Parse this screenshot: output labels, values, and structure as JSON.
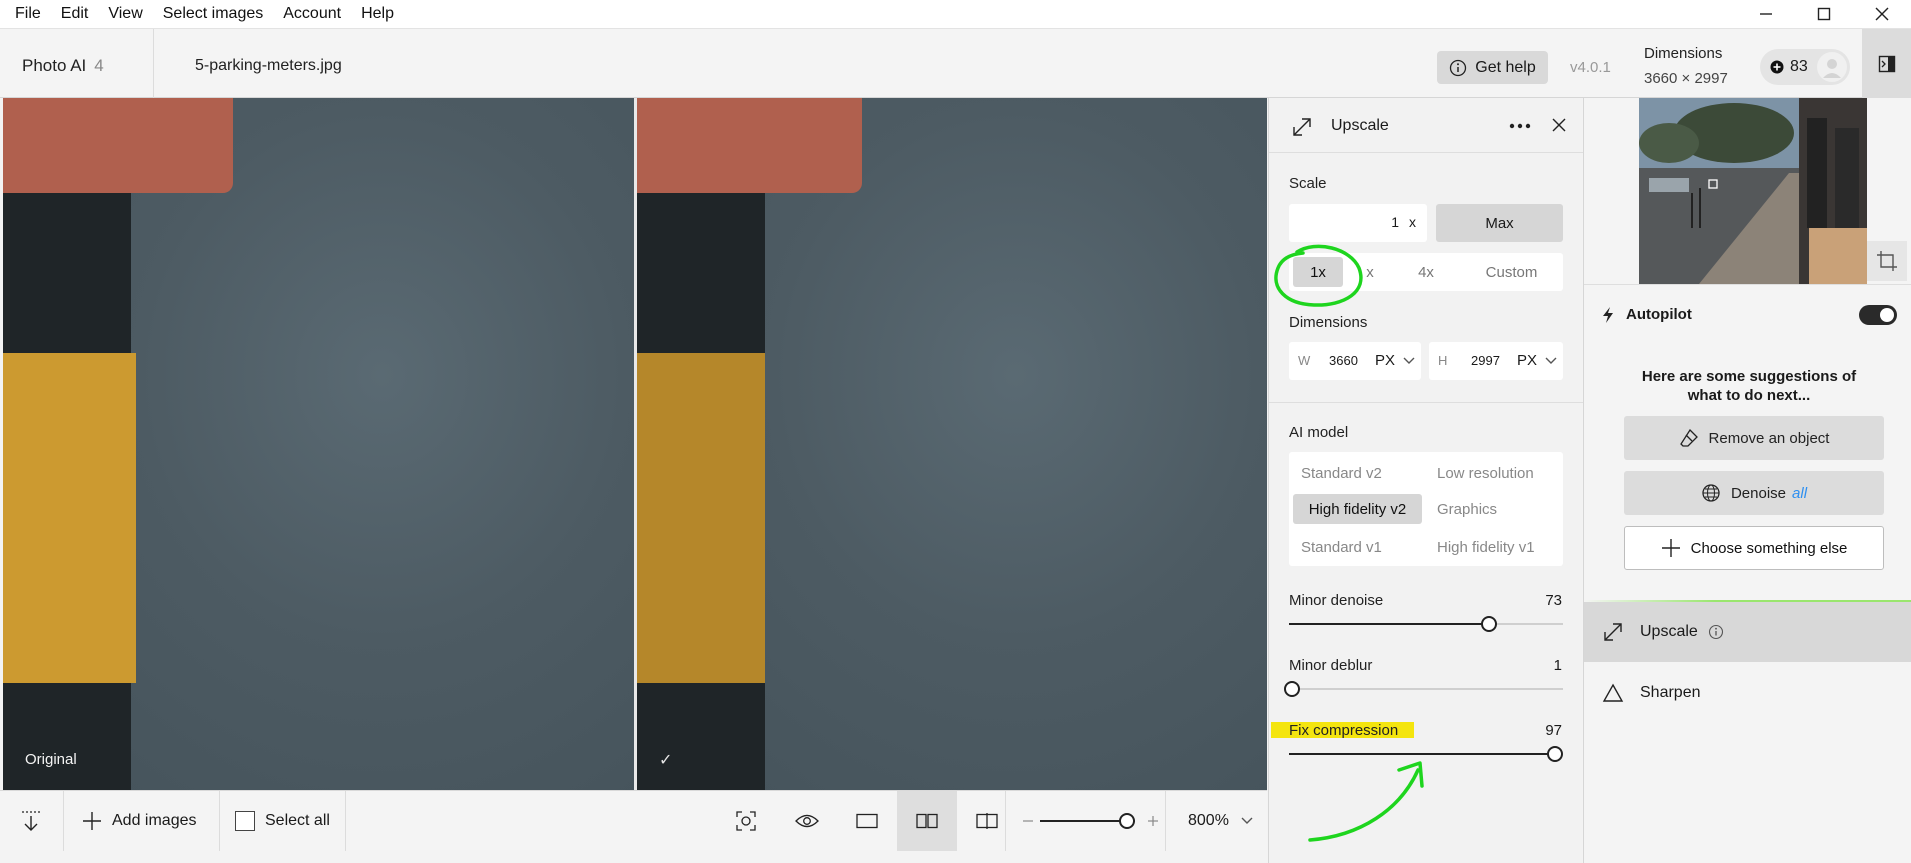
{
  "menu": [
    "File",
    "Edit",
    "View",
    "Select images",
    "Account",
    "Help"
  ],
  "header": {
    "app_name": "Photo AI",
    "app_count": "4",
    "filename": "5-parking-meters.jpg",
    "help_label": "Get help",
    "version": "v4.0.1",
    "dimensions_title": "Dimensions",
    "dimensions_value": "3660 × 2997",
    "credits": "83"
  },
  "viewer": {
    "left_label": "Original",
    "right_label": "✓"
  },
  "bottombar": {
    "add_images": "Add images",
    "select_all": "Select all",
    "zoom_value": "800%",
    "zoom_level": 0.92
  },
  "upscale": {
    "title": "Upscale",
    "scale_label": "Scale",
    "scale_value": "1",
    "scale_unit": "x",
    "max_label": "Max",
    "presets": [
      "1x",
      "x",
      "4x",
      "Custom"
    ],
    "dimensions_label": "Dimensions",
    "width_prefix": "W",
    "width_value": "3660",
    "width_unit": "PX",
    "height_prefix": "H",
    "height_value": "2997",
    "height_unit": "PX",
    "ai_model_label": "AI model",
    "models": [
      "Standard v2",
      "Low resolution",
      "High fidelity v2",
      "Graphics",
      "Standard v1",
      "High fidelity v1"
    ],
    "selected_model": "High fidelity v2",
    "sliders": [
      {
        "label": "Minor denoise",
        "value": "73",
        "fraction": 0.73
      },
      {
        "label": "Minor deblur",
        "value": "1",
        "fraction": 0.01
      },
      {
        "label": "Fix compression",
        "value": "97",
        "fraction": 0.97
      }
    ]
  },
  "right": {
    "autopilot_label": "Autopilot",
    "autopilot_on": true,
    "suggestion_text": "Here are some suggestions of what to do next...",
    "remove_object": "Remove an object",
    "denoise": "Denoise",
    "denoise_tag": "all",
    "choose_else": "Choose something else",
    "tools": [
      "Upscale",
      "Sharpen"
    ]
  },
  "colors": {
    "annotation_green": "#1ed51e",
    "highlight_yellow": "#f4e50f",
    "denoise_tag": "#2d8ff0"
  }
}
